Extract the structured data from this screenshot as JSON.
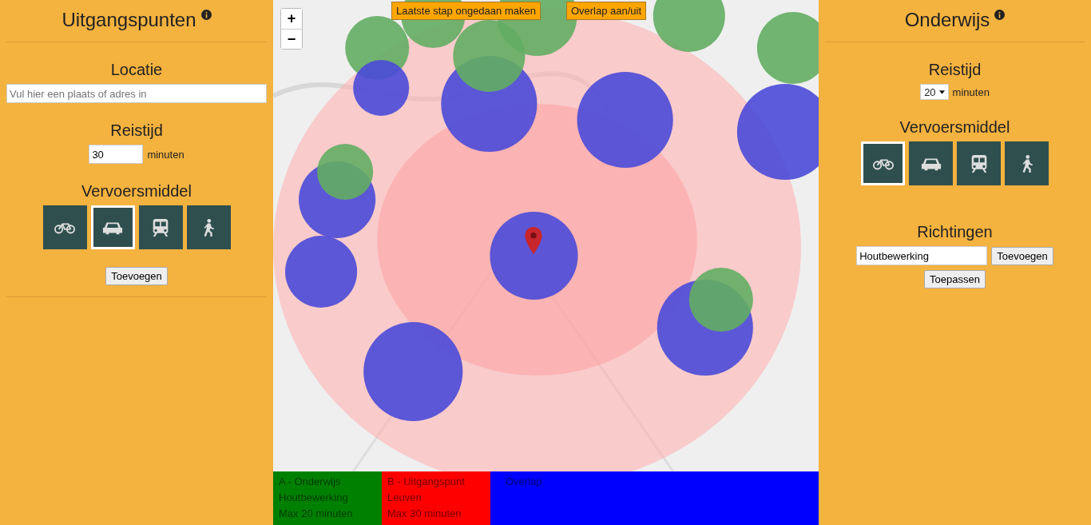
{
  "left_panel": {
    "title": "Uitgangspunten",
    "location": {
      "label": "Locatie",
      "placeholder": "Vul hier een plaats of adres in"
    },
    "travel_time": {
      "label": "Reistijd",
      "value": "30",
      "unit": "minuten"
    },
    "transport": {
      "label": "Vervoersmiddel",
      "options": [
        {
          "kind": "bike",
          "selected": false
        },
        {
          "kind": "car",
          "selected": true
        },
        {
          "kind": "train",
          "selected": false
        },
        {
          "kind": "walk",
          "selected": false
        }
      ]
    },
    "add_button": "Toevoegen"
  },
  "map": {
    "zoom_in": "+",
    "zoom_out": "−",
    "buttons": [
      "Laatste stap ongedaan maken",
      "Overlap aan/uit"
    ]
  },
  "legend": [
    {
      "color": "#008000",
      "lines": [
        "A - Onderwijs",
        "Houtbewerking",
        "Max 20 minuten"
      ]
    },
    {
      "color": "#ff0000",
      "lines": [
        "B - Uitgangspunt",
        "Leuven",
        "Max 30 minuten"
      ]
    },
    {
      "color": "#0000ff",
      "lines": [
        "Overlap"
      ]
    }
  ],
  "right_panel": {
    "title": "Onderwijs",
    "travel_time": {
      "label": "Reistijd",
      "value": "20",
      "unit": "minuten"
    },
    "transport": {
      "label": "Vervoersmiddel",
      "options": [
        {
          "kind": "bike",
          "selected": true
        },
        {
          "kind": "car",
          "selected": false
        },
        {
          "kind": "train",
          "selected": false
        },
        {
          "kind": "walk",
          "selected": false
        }
      ]
    },
    "directions": {
      "label": "Richtingen",
      "value": "Houtbewerking",
      "add_button": "Toevoegen",
      "apply_button": "Toepassen"
    }
  }
}
